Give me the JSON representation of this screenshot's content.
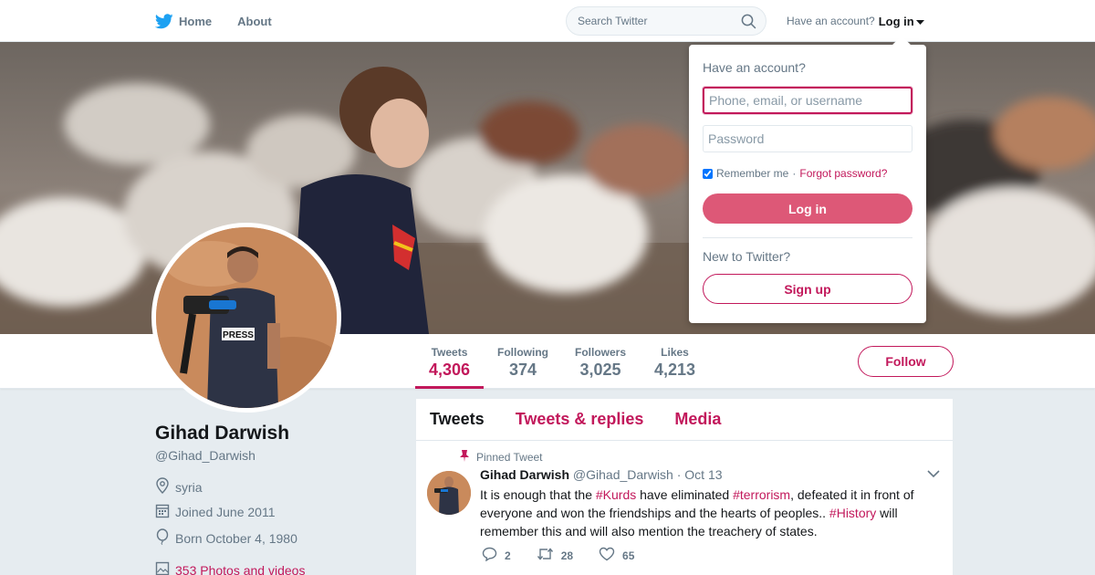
{
  "nav": {
    "home_label": "Home",
    "about_label": "About",
    "search_placeholder": "Search Twitter",
    "have_account": "Have an account?",
    "login_label": "Log in"
  },
  "profile": {
    "name": "Gihad Darwish",
    "handle": "@Gihad_Darwish",
    "location": "syria",
    "joined": "Joined June 2011",
    "born": "Born October 4, 1980",
    "photos_link": "353 Photos and videos",
    "follow_label": "Follow",
    "stats": [
      {
        "label": "Tweets",
        "value": "4,306"
      },
      {
        "label": "Following",
        "value": "374"
      },
      {
        "label": "Followers",
        "value": "3,025"
      },
      {
        "label": "Likes",
        "value": "4,213"
      }
    ]
  },
  "timeline": {
    "tabs": [
      "Tweets",
      "Tweets & replies",
      "Media"
    ],
    "pinned_tweet": {
      "pinned_label": "Pinned Tweet",
      "author_name": "Gihad Darwish",
      "author_handle": "@Gihad_Darwish",
      "date": "Oct 13",
      "text_parts": {
        "p1": "It is enough that the ",
        "tag1": "#Kurds",
        "p2": " have eliminated ",
        "tag2": "#terrorism",
        "p3": ", defeated it in front of everyone and won the friendships and the hearts of peoples.. ",
        "tag3": "#History",
        "p4": " will remember this and will also mention the treachery of states."
      },
      "replies": "2",
      "retweets": "28",
      "likes": "65"
    }
  },
  "login_dropdown": {
    "title": "Have an account?",
    "username_placeholder": "Phone, email, or username",
    "password_placeholder": "Password",
    "remember_label": "Remember me",
    "separator": "·",
    "forgot_label": "Forgot password?",
    "login_button": "Log in",
    "new_label": "New to Twitter?",
    "signup_button": "Sign up"
  },
  "colors": {
    "accent": "#c2185b",
    "login_button_bg": "#dd5877",
    "twitter_blue": "#1da1f2",
    "background": "#e6ecf0"
  }
}
